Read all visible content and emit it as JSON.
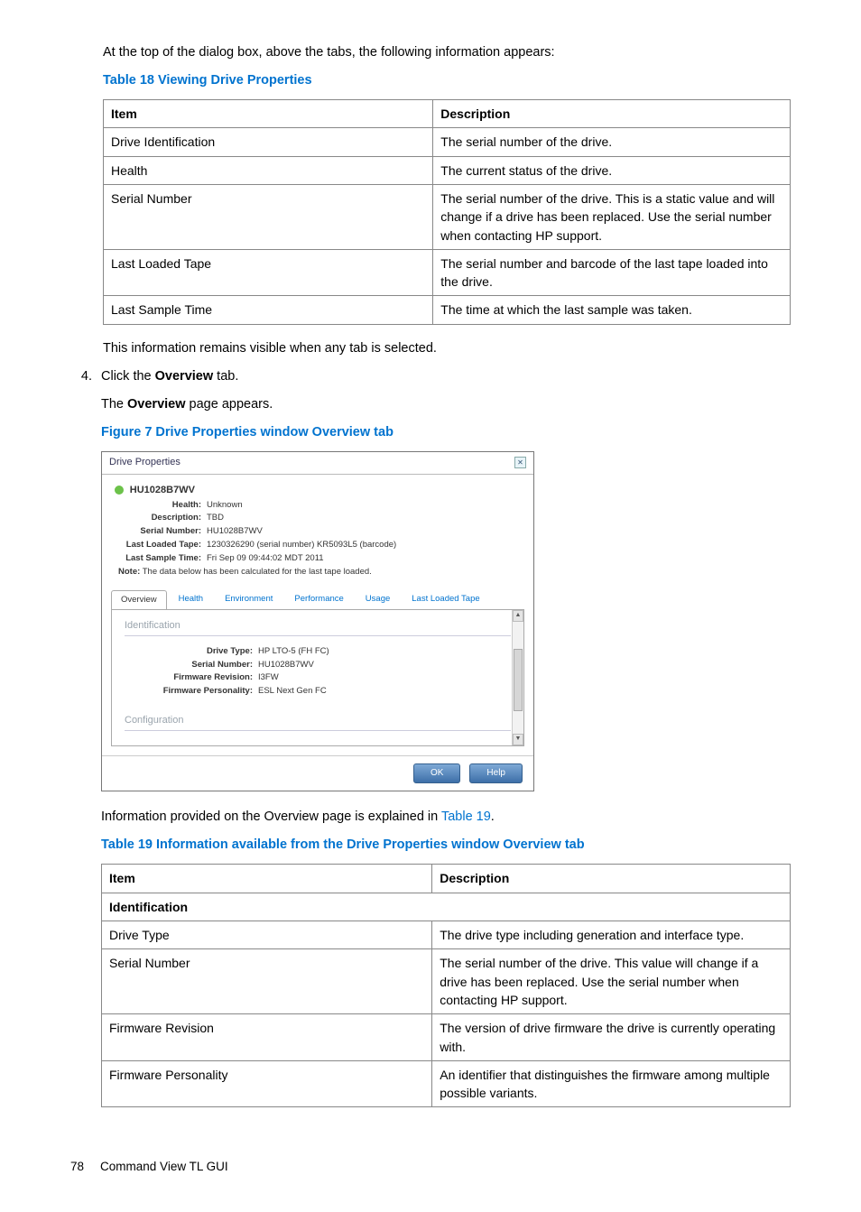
{
  "intro_para": "At the top of the dialog box, above the tabs, the following information appears:",
  "table18": {
    "title": "Table 18 Viewing Drive Properties",
    "headers": {
      "col1": "Item",
      "col2": "Description"
    },
    "rows": [
      {
        "item": "Drive Identification",
        "desc": "The serial number of the drive."
      },
      {
        "item": "Health",
        "desc": "The current status of the drive."
      },
      {
        "item": "Serial Number",
        "desc": "The serial number of the drive. This is a static value and will change if a drive has been replaced. Use the serial number when contacting HP support."
      },
      {
        "item": "Last Loaded Tape",
        "desc": "The serial number and barcode of the last tape loaded into the drive."
      },
      {
        "item": "Last Sample Time",
        "desc": "The time at which the last sample was taken."
      }
    ]
  },
  "para_after_t18": "This information remains visible when any tab is selected.",
  "step4": {
    "num": "4.",
    "line1_pre": "Click the ",
    "line1_bold": "Overview",
    "line1_post": " tab.",
    "line2_pre": "The ",
    "line2_bold": "Overview",
    "line2_post": " page appears."
  },
  "figure7": {
    "title": "Figure 7 Drive Properties window Overview tab",
    "window_title": "Drive Properties",
    "drive_name": "HU1028B7WV",
    "header_rows": [
      {
        "k": "Health:",
        "v": "Unknown"
      },
      {
        "k": "Description:",
        "v": "TBD"
      },
      {
        "k": "Serial Number:",
        "v": "HU1028B7WV"
      },
      {
        "k": "Last Loaded Tape:",
        "v": "1230326290 (serial number) KR5093L5 (barcode)"
      },
      {
        "k": "Last Sample Time:",
        "v": "Fri Sep 09 09:44:02 MDT 2011"
      }
    ],
    "note_k": "Note:",
    "note_v": " The data below has been calculated for the last tape loaded.",
    "tabs": [
      "Overview",
      "Health",
      "Environment",
      "Performance",
      "Usage",
      "Last Loaded Tape"
    ],
    "section_identification": "Identification",
    "ident_rows": [
      {
        "k": "Drive Type:",
        "v": "HP LTO-5 (FH FC)"
      },
      {
        "k": "Serial Number:",
        "v": "HU1028B7WV"
      },
      {
        "k": "Firmware Revision:",
        "v": "I3FW"
      },
      {
        "k": "Firmware Personality:",
        "v": "ESL Next Gen FC"
      }
    ],
    "section_configuration": "Configuration",
    "btn_ok": "OK",
    "btn_help": "Help"
  },
  "para_after_fig_pre": "Information provided on the Overview page is explained in ",
  "para_after_fig_link": "Table 19",
  "para_after_fig_post": ".",
  "table19": {
    "title": "Table 19 Information available from the Drive Properties window Overview tab",
    "headers": {
      "col1": "Item",
      "col2": "Description"
    },
    "section": "Identification",
    "rows": [
      {
        "item": "Drive Type",
        "desc": "The drive type including generation and interface type."
      },
      {
        "item": "Serial Number",
        "desc": "The serial number of the drive. This value will change if a drive has been replaced. Use the serial number when contacting HP support."
      },
      {
        "item": "Firmware Revision",
        "desc": "The version of drive firmware the drive is currently operating with."
      },
      {
        "item": "Firmware Personality",
        "desc": "An identifier that distinguishes the firmware among multiple possible variants."
      }
    ]
  },
  "footer": {
    "page": "78",
    "label": "Command View TL GUI"
  }
}
